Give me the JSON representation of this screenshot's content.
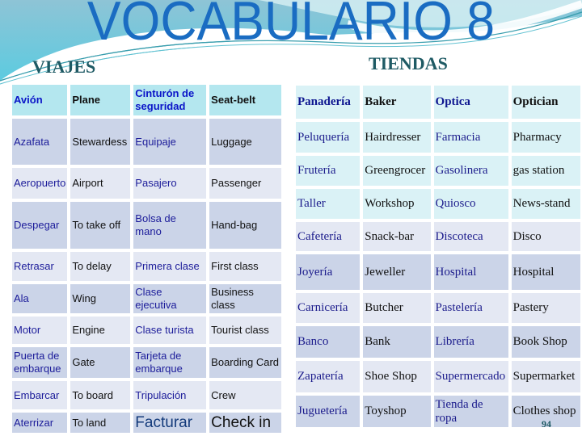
{
  "title": "VOCABULARIO 8",
  "sections": {
    "viajes": "VIAJES",
    "tiendas": "TIENDAS"
  },
  "viajes_table": {
    "rows": [
      [
        "Avión",
        "Plane",
        "Cinturón de seguridad",
        "Seat-belt"
      ],
      [
        "Azafata",
        "Stewardess",
        "Equipaje",
        "Luggage"
      ],
      [
        "Aeropuerto",
        "Airport",
        "Pasajero",
        "Passenger"
      ],
      [
        "Despegar",
        "To take off",
        "Bolsa de mano",
        "Hand-bag"
      ],
      [
        "Retrasar",
        "To delay",
        "Primera clase",
        "First class"
      ],
      [
        "Ala",
        "Wing",
        "Clase ejecutiva",
        "Business class"
      ],
      [
        "Motor",
        "Engine",
        "Clase turista",
        "Tourist class"
      ],
      [
        "Puerta de embarque",
        "Gate",
        "Tarjeta de embarque",
        "Boarding Card"
      ],
      [
        "Embarcar",
        "To board",
        "Tripulación",
        "Crew"
      ],
      [
        "Aterrizar",
        "To land",
        "Facturar",
        "Check in"
      ]
    ]
  },
  "tiendas_table": {
    "rows": [
      [
        "Panadería",
        "Baker",
        "Optica",
        "Optician"
      ],
      [
        "Peluquería",
        "Hairdresser",
        "Farmacia",
        "Pharmacy"
      ],
      [
        "Frutería",
        "Greengrocer",
        "Gasolinera",
        "gas station"
      ],
      [
        "Taller",
        "Workshop",
        "Quiosco",
        "News-stand"
      ],
      [
        "Cafetería",
        "Snack-bar",
        "Discoteca",
        "Disco"
      ],
      [
        "Joyería",
        "Jeweller",
        "Hospital",
        "Hospital"
      ],
      [
        "Carnicería",
        "Butcher",
        "Pastelería",
        "Pastery"
      ],
      [
        "Banco",
        "Bank",
        "Librería",
        "Book Shop"
      ],
      [
        "Zapatería",
        "Shoe Shop",
        "Supermercado",
        "Supermarket"
      ],
      [
        "Juguetería",
        "Toyshop",
        "Tienda de ropa",
        "Clothes shop"
      ]
    ]
  },
  "page_number": "94",
  "colors": {
    "title": "#1a6cc2",
    "section_title": "#1e5a64",
    "spanish_text": "#1c1c9a",
    "english_text": "#111111",
    "header_cyan": "#b4e7ef",
    "row_light": "#e4e8f3",
    "row_dark": "#cbd4e8",
    "row_pale_cyan": "#daf2f6"
  }
}
